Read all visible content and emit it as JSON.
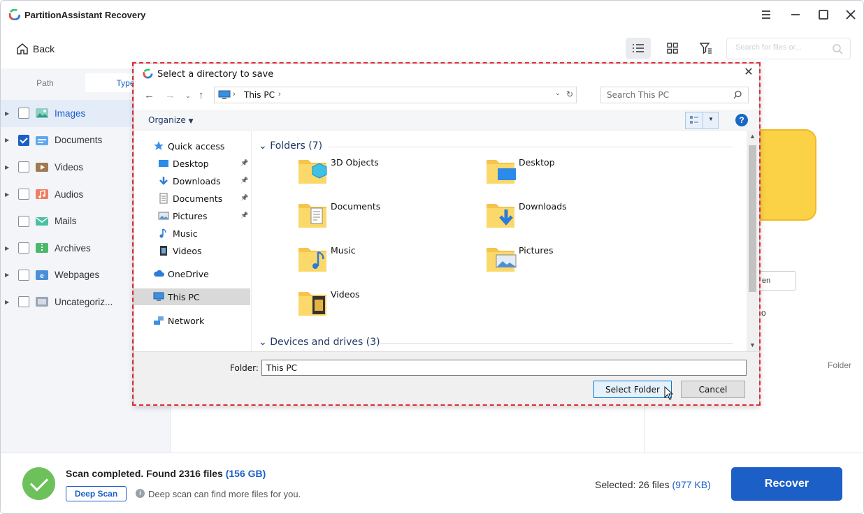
{
  "app": {
    "title": "PartitionAssistant Recovery",
    "back_label": "Back",
    "search_placeholder": "Search for files or..."
  },
  "left_panel": {
    "tabs": [
      {
        "label": "Path",
        "active": false
      },
      {
        "label": "Type",
        "active": true
      }
    ],
    "types": [
      {
        "label": "Images",
        "checked": false,
        "selected": true,
        "icon": "images-icon",
        "expandable": true
      },
      {
        "label": "Documents",
        "checked": true,
        "selected": false,
        "icon": "documents-icon",
        "expandable": true
      },
      {
        "label": "Videos",
        "checked": false,
        "selected": false,
        "icon": "videos-icon",
        "expandable": true
      },
      {
        "label": "Audios",
        "checked": false,
        "selected": false,
        "icon": "audios-icon",
        "expandable": true
      },
      {
        "label": "Mails",
        "checked": false,
        "selected": false,
        "icon": "mails-icon",
        "expandable": false
      },
      {
        "label": "Archives",
        "checked": false,
        "selected": false,
        "icon": "archives-icon",
        "expandable": true
      },
      {
        "label": "Webpages",
        "checked": false,
        "selected": false,
        "icon": "webpages-icon",
        "expandable": true
      },
      {
        "label": "Uncategoriz...",
        "checked": false,
        "selected": false,
        "icon": "uncategorized-icon",
        "expandable": true
      }
    ]
  },
  "right_panel": {
    "open_button_partial": "en",
    "path_partial": "o",
    "folder_label": "Folder"
  },
  "bottom": {
    "scan_status": "Scan completed. Found 2316 files",
    "scan_size": "(156 GB)",
    "deep_scan_label": "Deep Scan",
    "hint": "Deep scan can find more files for you.",
    "selected_label": "Selected: 26 files",
    "selected_size": "(977 KB)",
    "recover_label": "Recover"
  },
  "dialog": {
    "title": "Select a directory to save",
    "address": "This PC",
    "search_placeholder": "Search This PC",
    "organize_label": "Organize",
    "nav_items": [
      {
        "label": "Quick access",
        "icon": "star-icon",
        "indent": 0,
        "pinned": false,
        "selected": false
      },
      {
        "label": "Desktop",
        "icon": "desktop-icon",
        "indent": 1,
        "pinned": true,
        "selected": false
      },
      {
        "label": "Downloads",
        "icon": "downloads-icon",
        "indent": 1,
        "pinned": true,
        "selected": false
      },
      {
        "label": "Documents",
        "icon": "documents-icon",
        "indent": 1,
        "pinned": true,
        "selected": false
      },
      {
        "label": "Pictures",
        "icon": "pictures-icon",
        "indent": 1,
        "pinned": true,
        "selected": false
      },
      {
        "label": "Music",
        "icon": "music-icon",
        "indent": 1,
        "pinned": false,
        "selected": false
      },
      {
        "label": "Videos",
        "icon": "videos-icon",
        "indent": 1,
        "pinned": false,
        "selected": false
      },
      {
        "label": "OneDrive",
        "icon": "cloud-icon",
        "indent": 0,
        "pinned": false,
        "selected": false
      },
      {
        "label": "This PC",
        "icon": "pc-icon",
        "indent": 0,
        "pinned": false,
        "selected": true
      },
      {
        "label": "Network",
        "icon": "network-icon",
        "indent": 0,
        "pinned": false,
        "selected": false
      }
    ],
    "folders_header": "Folders (7)",
    "folders": [
      {
        "label": "3D Objects",
        "icon": "3d-objects-folder-icon"
      },
      {
        "label": "Desktop",
        "icon": "desktop-folder-icon"
      },
      {
        "label": "Documents",
        "icon": "documents-folder-icon"
      },
      {
        "label": "Downloads",
        "icon": "downloads-folder-icon"
      },
      {
        "label": "Music",
        "icon": "music-folder-icon"
      },
      {
        "label": "Pictures",
        "icon": "pictures-folder-icon"
      },
      {
        "label": "Videos",
        "icon": "videos-folder-icon"
      }
    ],
    "devices_header": "Devices and drives (3)",
    "folder_field_label": "Folder:",
    "folder_field_value": "This PC",
    "select_button": "Select Folder",
    "cancel_button": "Cancel"
  },
  "colors": {
    "accent": "#1b5fc7",
    "success": "#6dc15a",
    "highlight_outline": "#dd2b3a",
    "folder_yellow": "#fbd146"
  }
}
